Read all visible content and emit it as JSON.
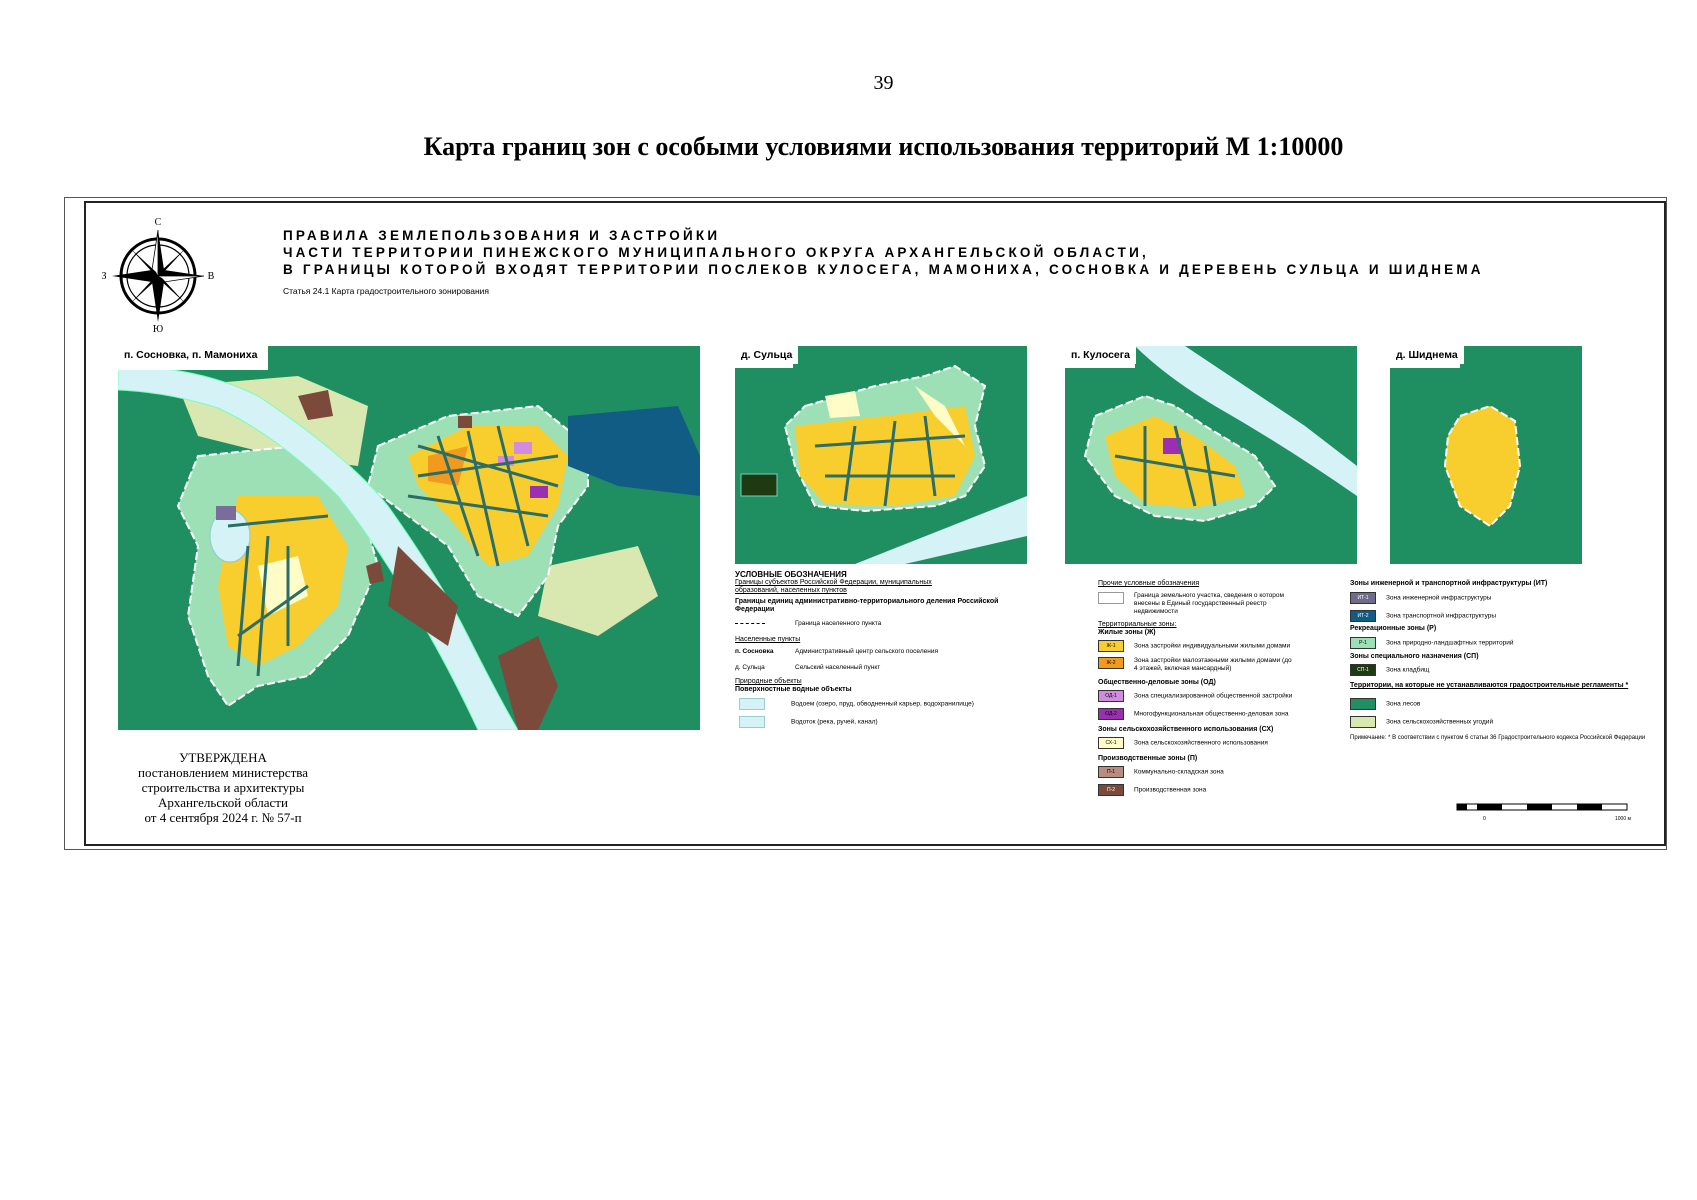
{
  "page_number": "39",
  "doc_title": "Карта границ зон с особыми условиями использования территорий М 1:10000",
  "sheet": {
    "header_lines": [
      "ПРАВИЛА ЗЕМЛЕПОЛЬЗОВАНИЯ И ЗАСТРОЙКИ",
      "ЧАСТИ ТЕРРИТОРИИ ПИНЕЖСКОГО МУНИЦИПАЛЬНОГО ОКРУГА АРХАНГЕЛЬСКОЙ ОБЛАСТИ,",
      "В ГРАНИЦЫ КОТОРОЙ ВХОДЯТ ТЕРРИТОРИИ ПОСЛЕКОВ  КУЛОСЕГА, МАМОНИХА, СОСНОВКА И ДЕРЕВЕНЬ СУЛЬЦА И ШИДНЕМА"
    ],
    "subtitle": "Статья 24.1 Карта градостроительного зонирования",
    "compass": {
      "n": "С",
      "s": "Ю",
      "w": "З",
      "e": "В"
    }
  },
  "maps": {
    "sosnovka": {
      "label": "п. Сосновка, п. Мамониха"
    },
    "sultsa": {
      "label": "д. Сульца"
    },
    "kulosega": {
      "label": "п. Кулосега"
    },
    "shidnema": {
      "label": "д. Шиднема"
    }
  },
  "colors": {
    "forest": "#1f8f62",
    "residential": "#f7ce2d",
    "residential_mid": "#f29a1e",
    "light_green": "#9ee0b6",
    "agri": "#fffcc8",
    "agri_land": "#d9e7b0",
    "water": "#d5f2f7",
    "prod": "#7b4a3a",
    "infra_blue": "#115c84",
    "od_pink": "#d18ce0",
    "od_purple": "#9b2fb1"
  },
  "legend": {
    "main_title": "УСЛОВНЫЕ ОБОЗНАЧЕНИЯ",
    "borders_title": "Границы субъектов Российской Федерации, муниципальных образований, населенных пунктов",
    "admin_borders": "Границы единиц административно-территориального деления Российской Федерации",
    "settlement_border": "Граница населенного пункта",
    "settlements_title": "Населенные пункты",
    "admin_center_sample": "п. Сосновка",
    "admin_center": "Административный центр сельского поселения",
    "rural_sample": "д. Сульца",
    "rural": "Сельский населенный пункт",
    "natural_title": "Природные объекты",
    "surface_water": "Поверхностные водные объекты",
    "reservoir": "Водоем (озеро, пруд, обводненный карьер, водохранилище)",
    "watercourse": "Водоток (река, ручей, канал)",
    "other_title": "Прочие условные обозначения",
    "land_plot": "Граница земельного участка, сведения о котором внесены в Единый государственный реестр недвижимости",
    "territorial_zones": "Территориальные зоны:",
    "residential_zones": "Жилые зоны (Ж)",
    "zh1_code": "Ж-1",
    "zh1": "Зона застройки индивидуальными жилыми домами",
    "zh2_code": "Ж-2",
    "zh2": "Зона застройки малоэтажными жилыми домами (до 4 этажей, включая мансардный)",
    "public_zones": "Общественно-деловые зоны (ОД)",
    "od1_code": "ОД-1",
    "od1": "Зона специализированной общественной застройки",
    "od2_code": "ОД-2",
    "od2": "Многофункциональная общественно-деловая зона",
    "agri_zones": "Зоны сельскохозяйственного использования (СХ)",
    "skh1_code": "СХ-1",
    "skh1": "Зона сельскохозяйственного использования",
    "prod_zones": "Производственные зоны (П)",
    "p1_code": "П-1",
    "p1": "Коммунально-складская зона",
    "p2_code": "П-2",
    "p2": "Производственная зона",
    "infra_zones": "Зоны инженерной и транспортной инфраструктуры (ИТ)",
    "it1_code": "ИТ-1",
    "it1": "Зона инженерной инфраструктуры",
    "it2_code": "ИТ-2",
    "it2": "Зона транспортной инфраструктуры",
    "rec_zones": "Рекреационные зоны (Р)",
    "r1_code": "Р-1",
    "r1": "Зона природно-ландшафтных территорий",
    "special_zones": "Зоны специального назначения (СП)",
    "sp1_code": "СП-1",
    "sp1": "Зона кладбищ",
    "no_regs_title": "Территории, на которые не устанавливаются градостроительные регламенты *",
    "forest": "Зона лесов",
    "agri_land": "Зона сельскохозяйственных угодий",
    "note": "Примечание: * В соответствии с пунктом 6 статьи 36 Градостроительного кодекса Российской Федерации"
  },
  "approval": [
    "УТВЕРЖДЕНА",
    "постановлением министерства",
    "строительства и архитектуры",
    "Архангельской области",
    "от 4 сентября 2024 г. № 57-п"
  ],
  "scalebar": {
    "start": "0",
    "end": "1000 м"
  }
}
